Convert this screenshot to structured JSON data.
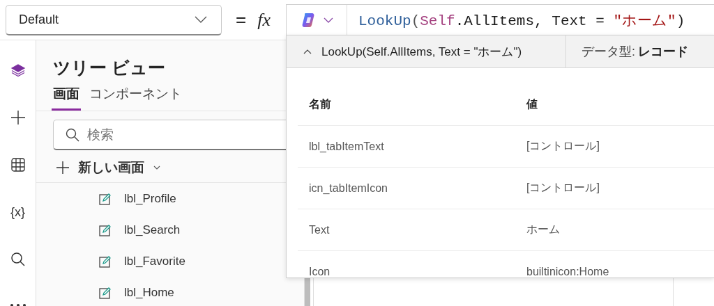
{
  "property_dropdown": {
    "value": "Default"
  },
  "formula_bar": {
    "equals": "=",
    "fx": "fx",
    "tokens": [
      {
        "kind": "function",
        "text": "LookUp"
      },
      {
        "kind": "punct",
        "text": "("
      },
      {
        "kind": "keyword",
        "text": "Self"
      },
      {
        "kind": "plain",
        "text": ".AllItems, Text = "
      },
      {
        "kind": "string",
        "text": "\"ホーム\""
      },
      {
        "kind": "plain",
        "text": ")"
      }
    ]
  },
  "result_popup": {
    "expression": "LookUp(Self.AllItems, Text = \"ホーム\")",
    "data_type_label": "データ型:",
    "data_type": "レコード",
    "columns": [
      "名前",
      "値"
    ],
    "rows": [
      {
        "name": "lbl_tabItemText",
        "value": "[コントロール]"
      },
      {
        "name": "icn_tabItemIcon",
        "value": "[コントロール]"
      },
      {
        "name": "Text",
        "value": "ホーム"
      },
      {
        "name": "Icon",
        "value": "builtinicon:Home"
      }
    ]
  },
  "rail": [
    {
      "kind": "layers",
      "selected": true
    },
    {
      "kind": "plus",
      "selected": false
    },
    {
      "kind": "table",
      "selected": false
    },
    {
      "kind": "variables",
      "selected": false,
      "label": "{x}"
    },
    {
      "kind": "search",
      "selected": false
    },
    {
      "kind": "more",
      "selected": false
    }
  ],
  "tree_panel": {
    "title": "ツリー ビュー",
    "tabs": [
      {
        "label": "画面",
        "selected": true
      },
      {
        "label": "コンポーネント",
        "selected": false
      }
    ],
    "search": {
      "placeholder": "検索"
    },
    "new_screen": "新しい画面",
    "items": [
      {
        "label": "lbl_Profile"
      },
      {
        "label": "lbl_Search"
      },
      {
        "label": "lbl_Favorite"
      },
      {
        "label": "lbl_Home"
      }
    ]
  }
}
